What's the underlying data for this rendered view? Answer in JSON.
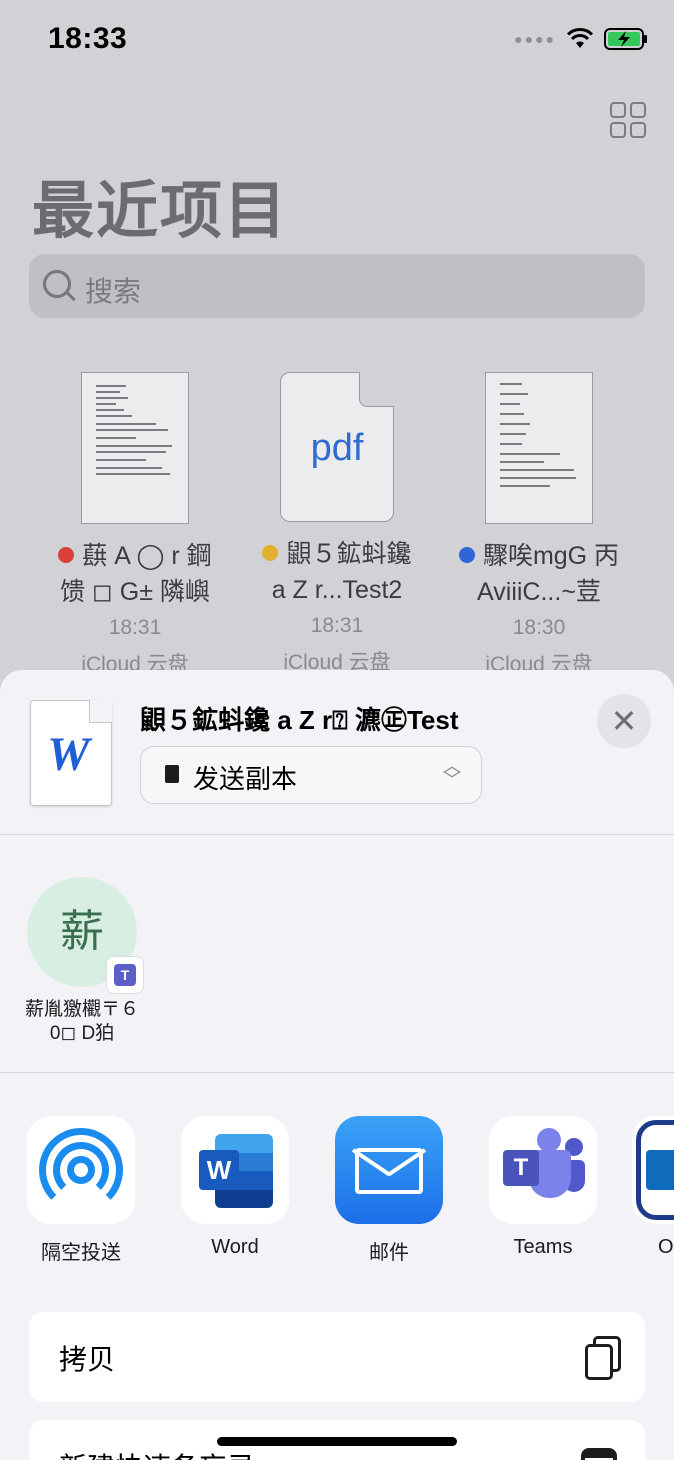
{
  "status": {
    "time": "18:33"
  },
  "page": {
    "title": "最近项目",
    "search_placeholder": "搜索"
  },
  "files": [
    {
      "line1": "蕻 A ◯ r 鋼",
      "line2": "馈 ◻ G± 隣嶼",
      "time": "18:31",
      "location": "iCloud 云盘",
      "tag_color": "#d9403a",
      "thumb": "doc"
    },
    {
      "line1": "鼰５鉱蚪鑱",
      "line2": "a Z r...Test2",
      "time": "18:31",
      "location": "iCloud 云盘",
      "tag_color": "#e0b02e",
      "thumb": "pdf",
      "thumb_text": "pdf"
    },
    {
      "line1": "驟唉mgG 丙",
      "line2": "AviiiC...~荳",
      "time": "18:30",
      "location": "iCloud 云盘",
      "tag_color": "#2e66d8",
      "thumb": "doc"
    }
  ],
  "sheet": {
    "doc_icon_letter": "W",
    "title": "鼰５鉱蚪鑱 a Z r⍰ 瀌㊣Test",
    "send_option": "发送副本",
    "close": "✕"
  },
  "people": [
    {
      "avatar_char": "薪",
      "badge": "T",
      "name_line1": "薪胤獥欟〒６",
      "name_line2": "0◻ D狛"
    }
  ],
  "apps": [
    {
      "label": "隔空投送",
      "icon": "airdrop-icon"
    },
    {
      "label": "Word",
      "icon": "word-icon"
    },
    {
      "label": "邮件",
      "icon": "mail-icon"
    },
    {
      "label": "Teams",
      "icon": "teams-icon"
    },
    {
      "label": "O",
      "icon": "outlook-icon"
    }
  ],
  "actions": [
    {
      "label": "拷贝",
      "icon": "copy-icon"
    },
    {
      "label": "新建快速备忘录",
      "icon": "quick-note-icon"
    }
  ]
}
